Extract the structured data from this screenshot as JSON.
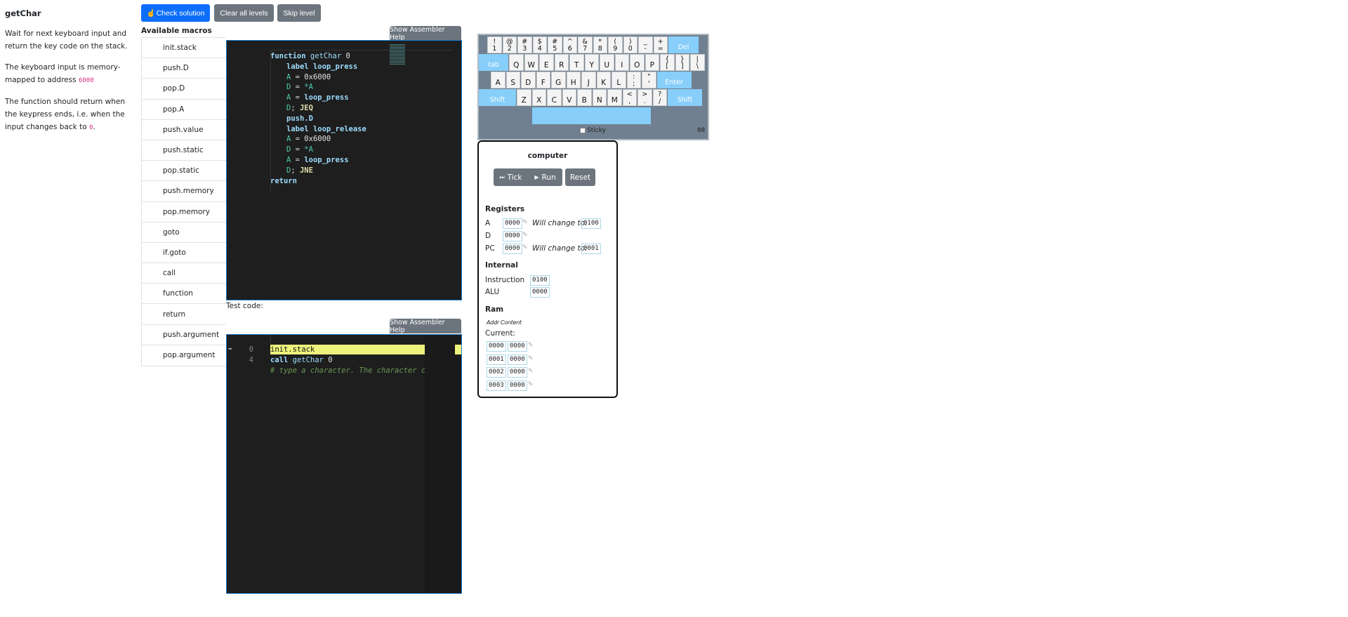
{
  "level": {
    "title": "getChar",
    "p1": "Wait for next keyboard input and return the key code on the stack.",
    "p2_pre": "The keyboard input is memory-mapped to address ",
    "p2_code": "6000",
    "p3_pre": "The function should return when the keypress ends, i.e. when the input changes back to ",
    "p3_code": "0",
    "p3_post": "."
  },
  "toolbar": {
    "check": "Check solution",
    "clear": "Clear all levels",
    "skip": "Skip level"
  },
  "macros": {
    "label": "Available macros",
    "items": [
      "init.stack",
      "push.D",
      "pop.D",
      "pop.A",
      "push.value",
      "push.static",
      "pop.static",
      "push.memory",
      "pop.memory",
      "goto",
      "if.goto",
      "call",
      "function",
      "return",
      "push.argument",
      "pop.argument"
    ]
  },
  "help_label": "Show Assembler Help",
  "editor1": {
    "lines": [
      {
        "indent": 0,
        "tokens": [
          [
            "function ",
            "kw"
          ],
          [
            "getChar ",
            "id"
          ],
          [
            "0",
            "num"
          ]
        ]
      },
      {
        "indent": 1,
        "tokens": [
          [
            "label ",
            "kw"
          ],
          [
            "loop_press",
            "kw"
          ]
        ]
      },
      {
        "indent": 1,
        "tokens": [
          [
            "A",
            "reg"
          ],
          [
            " = ",
            "op"
          ],
          [
            "0x6000",
            "num"
          ]
        ]
      },
      {
        "indent": 1,
        "tokens": [
          [
            "D",
            "reg"
          ],
          [
            " = ",
            "op"
          ],
          [
            "*A",
            "reg"
          ]
        ]
      },
      {
        "indent": 1,
        "tokens": [
          [
            "A",
            "reg"
          ],
          [
            " = ",
            "op"
          ],
          [
            "loop_press",
            "kw"
          ]
        ]
      },
      {
        "indent": 1,
        "tokens": [
          [
            "D",
            "reg"
          ],
          [
            "; ",
            "op"
          ],
          [
            "JEQ",
            "jmp"
          ]
        ]
      },
      {
        "indent": 1,
        "tokens": [
          [
            "push.D",
            "kw"
          ]
        ]
      },
      {
        "indent": 1,
        "tokens": [
          [
            "label ",
            "kw"
          ],
          [
            "loop_release",
            "kw"
          ]
        ]
      },
      {
        "indent": 1,
        "tokens": [
          [
            "A",
            "reg"
          ],
          [
            " = ",
            "op"
          ],
          [
            "0x6000",
            "num"
          ]
        ]
      },
      {
        "indent": 1,
        "tokens": [
          [
            "D",
            "reg"
          ],
          [
            " = ",
            "op"
          ],
          [
            "*A",
            "reg"
          ]
        ]
      },
      {
        "indent": 1,
        "tokens": [
          [
            "A",
            "reg"
          ],
          [
            " = ",
            "op"
          ],
          [
            "loop_press",
            "kw"
          ]
        ]
      },
      {
        "indent": 1,
        "tokens": [
          [
            "D",
            "reg"
          ],
          [
            "; ",
            "op"
          ],
          [
            "JNE",
            "jmp"
          ]
        ]
      },
      {
        "indent": 0,
        "tokens": [
          [
            "return",
            "kw"
          ]
        ]
      }
    ]
  },
  "test_label": "Test code:",
  "editor2": {
    "lines": [
      {
        "num": "0",
        "current": true,
        "tokens": [
          [
            "init.stack",
            "cur"
          ]
        ]
      },
      {
        "num": "4",
        "current": false,
        "tokens": [
          [
            "call ",
            "kw"
          ],
          [
            "getChar ",
            "id"
          ],
          [
            "0",
            "num"
          ]
        ]
      },
      {
        "num": "",
        "current": false,
        "tokens": [
          [
            "# type a character. The character code",
            "cmt"
          ]
        ]
      }
    ]
  },
  "keyboard": {
    "rows": [
      [
        [
          "!",
          "1"
        ],
        [
          "@",
          "2"
        ],
        [
          "#",
          "3"
        ],
        [
          "$",
          "4"
        ],
        [
          "#",
          "5"
        ],
        [
          "^",
          "6"
        ],
        [
          "&",
          "7"
        ],
        [
          "*",
          "8"
        ],
        [
          "(",
          "9"
        ],
        [
          ")",
          "0"
        ],
        [
          "_",
          "-"
        ],
        [
          "+",
          "="
        ],
        [
          "Del"
        ]
      ],
      [
        [
          "tab"
        ],
        [
          "Q"
        ],
        [
          "W"
        ],
        [
          "E"
        ],
        [
          "R"
        ],
        [
          "T"
        ],
        [
          "Y"
        ],
        [
          "U"
        ],
        [
          "I"
        ],
        [
          "O"
        ],
        [
          "P"
        ],
        [
          "{",
          "["
        ],
        [
          "}",
          "]"
        ],
        [
          "|",
          "\\"
        ]
      ],
      [
        [
          "A"
        ],
        [
          "S"
        ],
        [
          "D"
        ],
        [
          "F"
        ],
        [
          "G"
        ],
        [
          "H"
        ],
        [
          "J"
        ],
        [
          "K"
        ],
        [
          "L"
        ],
        [
          ":",
          ";"
        ],
        [
          "\"",
          "'"
        ],
        [
          "Enter"
        ]
      ],
      [
        [
          "Shift"
        ],
        [
          "Z"
        ],
        [
          "X"
        ],
        [
          "C"
        ],
        [
          "V"
        ],
        [
          "B"
        ],
        [
          "N"
        ],
        [
          "M"
        ],
        [
          "<",
          ","
        ],
        [
          ">",
          "."
        ],
        [
          "?",
          "/"
        ],
        [
          "Shift"
        ]
      ]
    ],
    "sticky": "Sticky",
    "code": "00",
    "special_color": "#87cefa"
  },
  "computer": {
    "title": "computer",
    "tick": "Tick",
    "run": "Run",
    "reset": "Reset",
    "registers_label": "Registers",
    "will_change": "Will change to:",
    "A": {
      "label": "A",
      "value": "0000",
      "next": "0100"
    },
    "D": {
      "label": "D",
      "value": "0000"
    },
    "PC": {
      "label": "PC",
      "value": "0000",
      "next": "0001"
    },
    "internal_label": "Internal",
    "instruction": {
      "label": "Instruction",
      "value": "0100"
    },
    "alu": {
      "label": "ALU",
      "value": "0000"
    },
    "ram_label": "Ram",
    "ram_cols": "Addr Content",
    "current": "Current:",
    "ram": [
      [
        "0000",
        "0000"
      ],
      [
        "0001",
        "0000"
      ],
      [
        "0002",
        "0000"
      ],
      [
        "0003",
        "0000"
      ]
    ]
  }
}
